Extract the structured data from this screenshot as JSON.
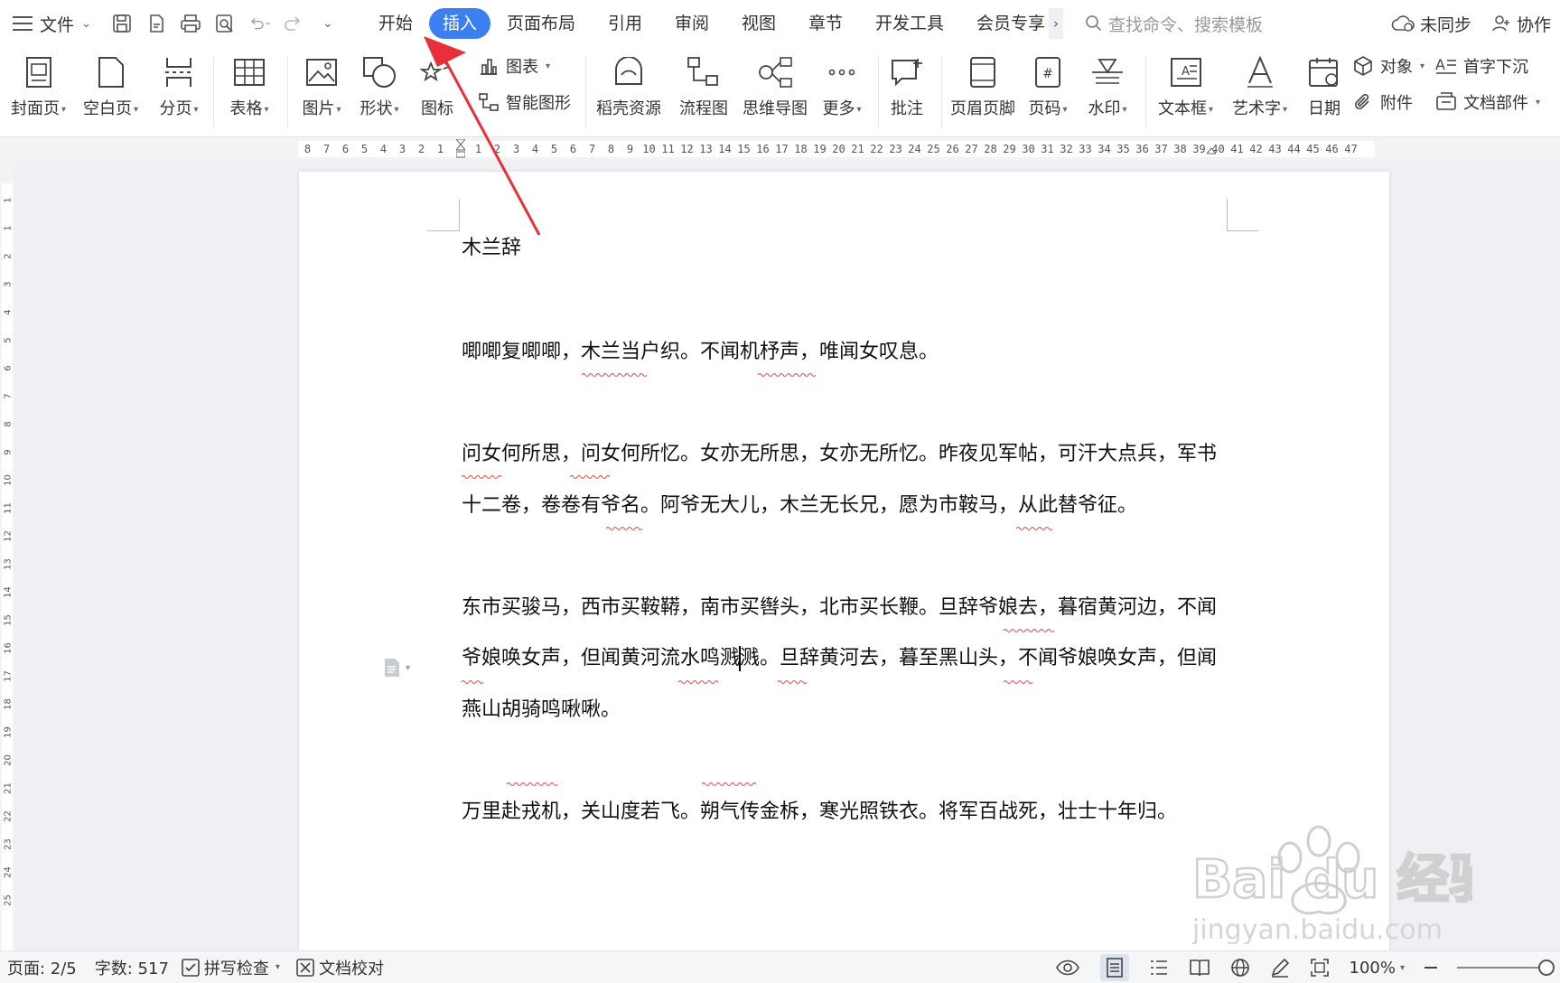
{
  "topbar": {
    "file_label": "文件",
    "tabs": [
      {
        "label": "开始",
        "active": false
      },
      {
        "label": "插入",
        "active": true
      },
      {
        "label": "页面布局",
        "active": false
      },
      {
        "label": "引用",
        "active": false
      },
      {
        "label": "审阅",
        "active": false
      },
      {
        "label": "视图",
        "active": false
      },
      {
        "label": "章节",
        "active": false
      },
      {
        "label": "开发工具",
        "active": false
      },
      {
        "label": "会员专享",
        "active": false
      }
    ],
    "more_arrow": "›",
    "search_placeholder": "查找命令、搜索模板",
    "sync_label": "未同步",
    "collab_label": "协作"
  },
  "ribbon": {
    "cover": "封面页",
    "blank": "空白页",
    "pagebreak": "分页",
    "table": "表格",
    "picture": "图片",
    "shape": "形状",
    "icon": "图标",
    "chart": "图表",
    "smartart": "智能图形",
    "docer": "稻壳资源",
    "flowchart": "流程图",
    "mindmap": "思维导图",
    "more": "更多",
    "comment": "批注",
    "header_footer": "页眉页脚",
    "page_number": "页码",
    "watermark": "水印",
    "textbox": "文本框",
    "wordart": "艺术字",
    "date": "日期",
    "object": "对象",
    "dropcap": "首字下沉",
    "attachment": "附件",
    "docpart": "文档部件"
  },
  "ruler": {
    "numbers": [
      "8",
      "7",
      "6",
      "5",
      "4",
      "3",
      "2",
      "1",
      "",
      "1",
      "2",
      "3",
      "4",
      "5",
      "6",
      "7",
      "8",
      "9",
      "10",
      "11",
      "12",
      "13",
      "14",
      "15",
      "16",
      "17",
      "18",
      "19",
      "20",
      "21",
      "22",
      "23",
      "24",
      "25",
      "26",
      "27",
      "28",
      "29",
      "30",
      "31",
      "32",
      "33",
      "34",
      "35",
      "36",
      "37",
      "38",
      "39",
      "40",
      "41",
      "42",
      "43",
      "44",
      "45",
      "46",
      "47"
    ],
    "vertical_numbers": [
      "1",
      "1",
      "2",
      "3",
      "4",
      "5",
      "6",
      "7",
      "8",
      "9",
      "10",
      "11",
      "12",
      "13",
      "14",
      "15",
      "16",
      "17",
      "18",
      "19",
      "20",
      "21",
      "22",
      "23",
      "24",
      "25"
    ]
  },
  "document": {
    "title": "木兰辞",
    "lines": {
      "p1": "唧唧复唧唧，木兰当户织。不闻机杼声，唯闻女叹息。",
      "p2a": "问女何所思，问女何所忆。女亦无所思，女亦无所忆。昨夜见军帖，可汗大点兵，军书",
      "p2b": "十二卷，卷卷有爷名。阿爷无大儿，木兰无长兄，愿为市鞍马，从此替爷征。",
      "p3a": "东市买骏马，西市买鞍鞯，南市买辔头，北市买长鞭。旦辞爷娘去，暮宿黄河边，不闻",
      "p3b_pre": "爷娘唤女声，但闻黄河流水鸣溅",
      "p3b_post": "溅。旦辞黄河去，暮至黑山头，不闻爷娘唤女声，但闻",
      "p3c": "燕山胡骑鸣啾啾。",
      "p4": "万里赴戎机，关山度若飞。朔气传金柝，寒光照铁衣。将军百战死，壮士十年归。"
    }
  },
  "watermark": {
    "brand": "Bai du 经验",
    "url": "jingyan.baidu.com"
  },
  "statusbar": {
    "page": "页面: 2/5",
    "wordcount": "字数: 517",
    "spellcheck": "拼写检查",
    "proofread": "文档校对",
    "zoom": "100%"
  },
  "colors": {
    "accent": "#3b7ff0",
    "arrow": "#e8303a",
    "spell_error": "#e64545"
  }
}
